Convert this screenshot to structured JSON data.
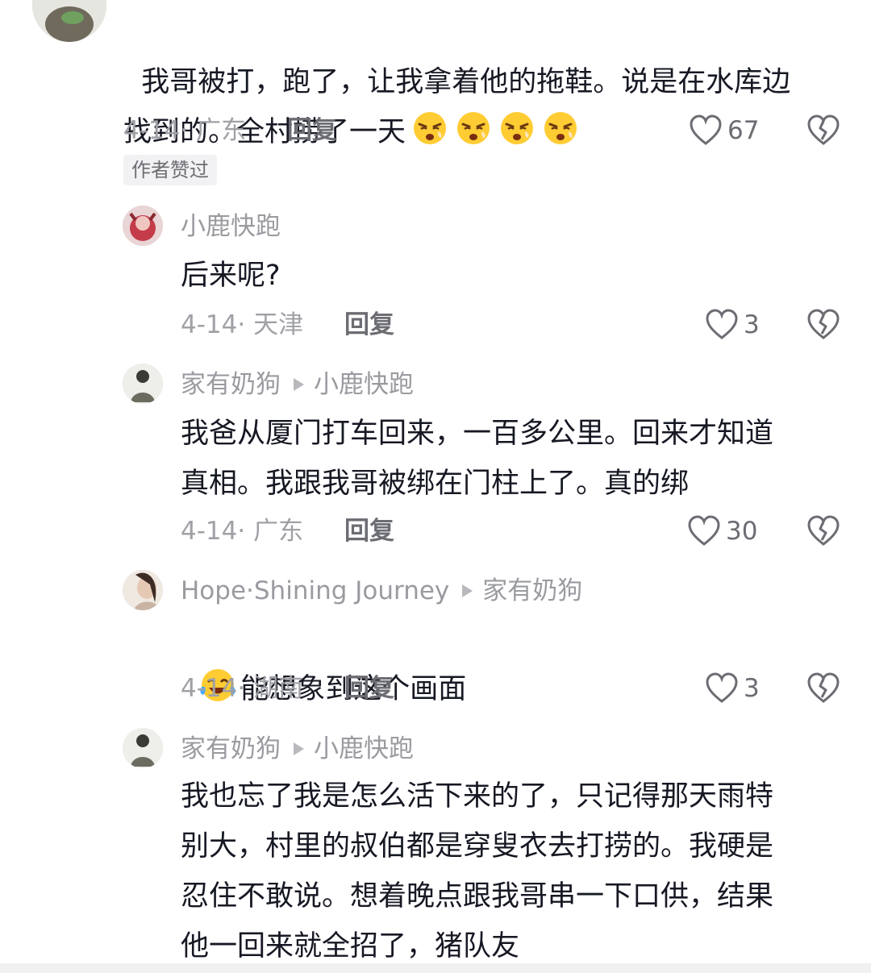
{
  "comments": [
    {
      "text": "我哥被打，跑了，让我拿着他的拖鞋。说是在水库边\n找到的。全村捞了一天",
      "emoji": "weary-face",
      "date": "4-14·",
      "location": "广东",
      "reply_label": "回复",
      "likes": "67",
      "badge": "作者赞过"
    },
    {
      "author": "小鹿快跑",
      "text": "后来呢?",
      "date": "4-14·",
      "location": "天津",
      "reply_label": "回复",
      "likes": "3"
    },
    {
      "author": "家有奶狗",
      "reply_to": "小鹿快跑",
      "text": "我爸从厦门打车回来，一百多公里。回来才知道\n真相。我跟我哥被绑在门柱上了。真的绑",
      "date": "4-14·",
      "location": "广东",
      "reply_label": "回复",
      "likes": "30"
    },
    {
      "author": "Hope·Shining Journey",
      "reply_to": "家有奶狗",
      "text": "能想象到这个画面",
      "emoji": "laughing-tears-face",
      "date": "4-14·",
      "location": "湖南",
      "reply_label": "回复",
      "likes": "3"
    },
    {
      "author": "家有奶狗",
      "reply_to": "小鹿快跑",
      "text": "我也忘了我是怎么活下来的了，只记得那天雨特\n别大，村里的叔伯都是穿叟衣去打捞的。我硬是\n忍住不敢说。想着晚点跟我哥串一下口供，结果\n他一回来就全招了，猪队友"
    }
  ],
  "colors": {
    "text": "#161823",
    "secondary": "#9a9ba0",
    "accent_badge_bg": "#f2f2f4"
  }
}
